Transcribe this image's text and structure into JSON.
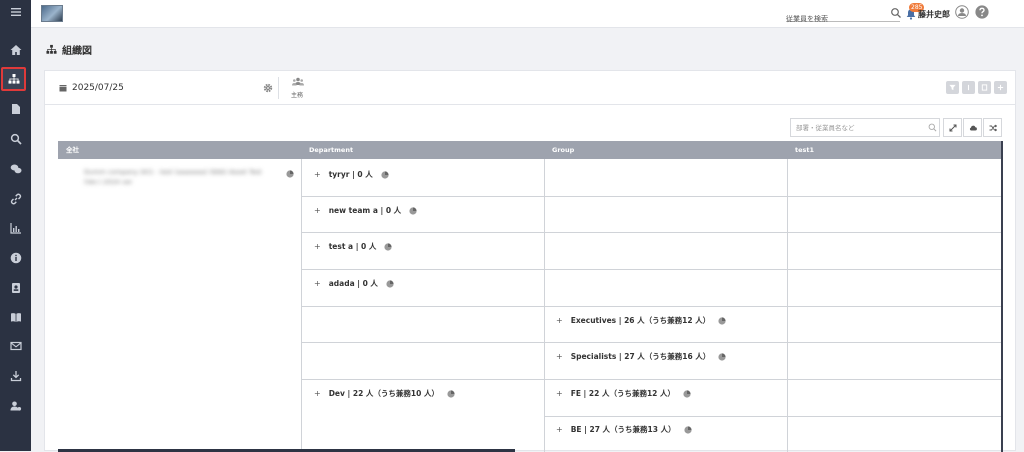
{
  "header": {
    "search_placeholder": "従業員を検索",
    "notification_count": "285",
    "user_name": "藤井史郎"
  },
  "page": {
    "title": "組織図"
  },
  "toolbar": {
    "date": "2025/07/25",
    "main_label": "主務"
  },
  "filter": {
    "placeholder": "部署・従業員名など"
  },
  "table": {
    "columns": [
      "全社",
      "Department",
      "Group",
      "test1"
    ],
    "company_name": "Dumm company (A)1 - test (aaaaaaa) (bbb) Asset Test (Ver.) 2024 ver",
    "rows": [
      {
        "department": "tyryr | 0 人",
        "group": ""
      },
      {
        "department": "new team a | 0 人",
        "group": ""
      },
      {
        "department": "test a | 0 人",
        "group": ""
      },
      {
        "department": "adada | 0 人",
        "group": ""
      },
      {
        "department": "",
        "group": "Executives | 26 人（うち兼務12 人）"
      },
      {
        "department": "",
        "group": "Specialists | 27 人（うち兼務16 人）"
      },
      {
        "department": "Dev | 22 人（うち兼務10 人）",
        "group": "FE | 22 人（うち兼務12 人）"
      },
      {
        "department": "",
        "group": "BE | 27 人（うち兼務13 人）"
      }
    ]
  },
  "colors": {
    "sidebar_bg": "#2b3242",
    "active_highlight": "#e03a3a",
    "badge": "#f07b3a",
    "table_header": "#9ea3ae"
  },
  "sidebar_icons": [
    "menu-icon",
    "home-icon",
    "org-chart-icon",
    "document-icon",
    "search-icon",
    "chat-icon",
    "link-icon",
    "chart-icon",
    "info-icon",
    "contact-card-icon",
    "book-icon",
    "mail-icon",
    "download-icon",
    "user-settings-icon"
  ]
}
